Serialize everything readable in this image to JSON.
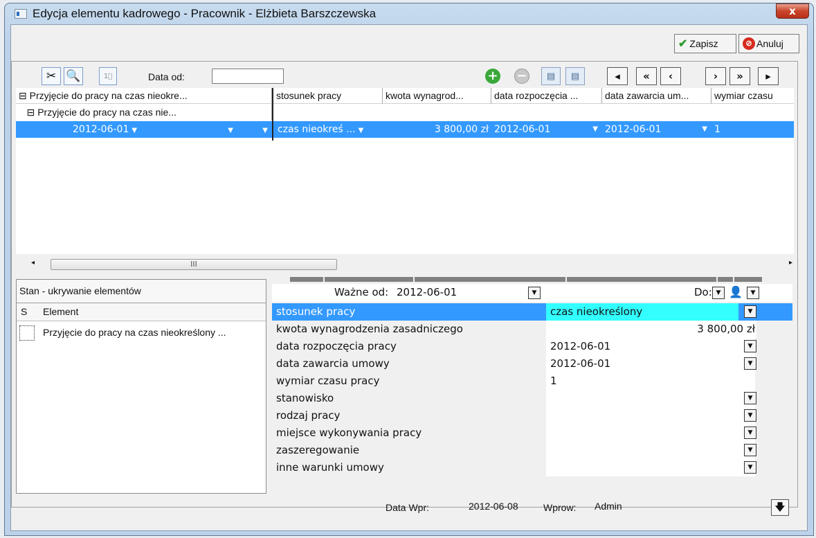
{
  "window": {
    "title": "Edycja elementu kadrowego - Pracownik - Elżbieta Barszczewska",
    "close": "x"
  },
  "actions": {
    "save": "Zapisz",
    "cancel": "Anuluj"
  },
  "toolbar": {
    "date_from_label": "Data od:",
    "date_from_value": ""
  },
  "grid": {
    "columns": [
      "Przyjęcie do pracy na czas nieokre...",
      "stosunek pracy",
      "kwota wynagrod...",
      "data rozpoczęcia ...",
      "data zawarcia um...",
      "wymiar czasu"
    ],
    "tree_child": "Przyjęcie do pracy na czas nie...",
    "selected_row": {
      "date": "2012-06-01",
      "stosunek": "czas nieokreś ...",
      "kwota": "3 800,00 zł",
      "data_rozp": "2012-06-01",
      "data_zaw": "2012-06-01",
      "wymiar": "1"
    }
  },
  "scrollbar": {
    "thumb_glyph": "III"
  },
  "state_panel": {
    "title": "Stan - ukrywanie elementów",
    "col_s": "S",
    "col_element": "Element",
    "row_element": "Przyjęcie do pracy na czas nieokreślony ..."
  },
  "props": {
    "valid_from_label": "Ważne od:",
    "valid_from_value": "2012-06-01",
    "to_label": "Do:",
    "rows": [
      {
        "label": "stosunek pracy",
        "value": "czas nieokreślony"
      },
      {
        "label": "kwota wynagrodzenia zasadniczego",
        "value": "3 800,00 zł"
      },
      {
        "label": "data rozpoczęcia pracy",
        "value": "2012-06-01"
      },
      {
        "label": "data zawarcia umowy",
        "value": "2012-06-01"
      },
      {
        "label": "wymiar czasu pracy",
        "value": "1"
      },
      {
        "label": "stanowisko",
        "value": ""
      },
      {
        "label": "rodzaj pracy",
        "value": ""
      },
      {
        "label": "miejsce wykonywania pracy",
        "value": ""
      },
      {
        "label": "zaszeregowanie",
        "value": ""
      },
      {
        "label": "inne warunki umowy",
        "value": ""
      }
    ]
  },
  "footer": {
    "entry_date_label": "Data Wpr:",
    "entry_date": "2012-06-08",
    "entered_by_label": "Wprow:",
    "entered_by": "Admin"
  },
  "colors": {
    "selection": "#3399ff",
    "highlight_value": "#33ffff"
  }
}
